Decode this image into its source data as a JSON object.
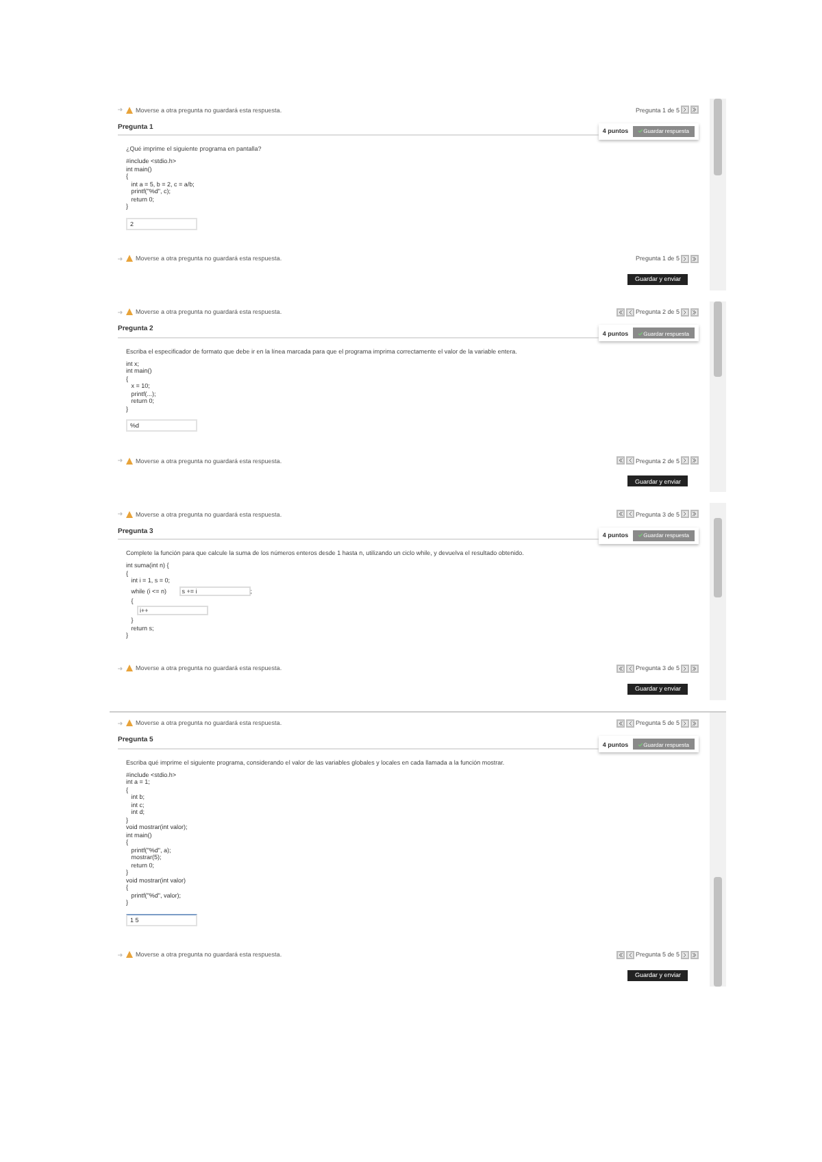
{
  "panels": [
    {
      "warning": "Moverse a otra pregunta no guardará esta respuesta.",
      "nav": {
        "label": "Pregunta 1 de 5",
        "previous": false
      },
      "question": {
        "title": "Pregunta 1",
        "points": "4 puntos",
        "save": "Guardar respuesta",
        "prompt": "¿Qué imprime el siguiente programa en pantalla?",
        "code": [
          [
            {
              "kind": "text",
              "text": "#include <stdio.h>"
            }
          ],
          [
            {
              "kind": "text",
              "text": "int main()"
            }
          ],
          [
            {
              "kind": "text",
              "text": "{"
            }
          ],
          [
            {
              "kind": "text",
              "text": "   int a = 5, b = 2, c = a/b;"
            }
          ],
          [
            {
              "kind": "text",
              "text": "   printf(\"%d\", c);"
            }
          ],
          [
            {
              "kind": "text",
              "text": "   return 0;"
            }
          ],
          [
            {
              "kind": "text",
              "text": "}"
            }
          ]
        ],
        "answer": "2"
      },
      "bottom_warning": "Moverse a otra pregunta no guardará esta respuesta.",
      "bottom_nav": {
        "label": "Pregunta 1 de 5",
        "previous": false
      },
      "action": "Guardar y enviar"
    },
    {
      "warning": "Moverse a otra pregunta no guardará esta respuesta.",
      "nav": {
        "label": "Pregunta 2 de 5",
        "previous": true
      },
      "question": {
        "title": "Pregunta 2",
        "points": "4 puntos",
        "save": "Guardar respuesta",
        "prompt": "Escriba el especificador de formato que debe ir en la línea marcada para que el programa imprima correctamente el valor de la variable entera.",
        "code": [
          [
            {
              "kind": "text",
              "text": "int x;"
            }
          ],
          [
            {
              "kind": "text",
              "text": "int main()"
            }
          ],
          [
            {
              "kind": "text",
              "text": "{"
            }
          ],
          [
            {
              "kind": "text",
              "text": "   x = 10;"
            }
          ],
          [
            {
              "kind": "text",
              "text": "   printf(...);"
            }
          ],
          [
            {
              "kind": "text",
              "text": "   return 0;"
            }
          ],
          [
            {
              "kind": "text",
              "text": "}"
            }
          ]
        ],
        "answer": "%d"
      },
      "bottom_warning": "Moverse a otra pregunta no guardará esta respuesta.",
      "bottom_nav": {
        "label": "Pregunta 2 de 5",
        "previous": true
      },
      "action": "Guardar y enviar"
    },
    {
      "warning": "Moverse a otra pregunta no guardará esta respuesta.",
      "nav": {
        "label": "Pregunta 3 de 5",
        "previous": true
      },
      "question": {
        "title": "Pregunta 3",
        "points": "4 puntos",
        "save": "Guardar respuesta",
        "prompt": "Complete la función para que calcule la suma de los números enteros desde 1 hasta n, utilizando un ciclo while, y devuelva el resultado obtenido.",
        "code": [
          [
            {
              "kind": "text",
              "text": "int suma(int n) {"
            }
          ],
          [
            {
              "kind": "text",
              "text": "{"
            }
          ],
          [
            {
              "kind": "text",
              "text": "   int i = 1, s = 0;"
            }
          ],
          [
            {
              "kind": "text",
              "text": "   while (i <= n) "
            },
            {
              "kind": "field",
              "text": "s += i"
            },
            {
              "kind": "text",
              "text": ";"
            }
          ],
          [
            {
              "kind": "text",
              "text": "   {"
            }
          ],
          [
            {
              "kind": "field",
              "text": "i++"
            }
          ],
          [
            {
              "kind": "text",
              "text": "   }"
            }
          ],
          [
            {
              "kind": "text",
              "text": "   return s;"
            }
          ],
          [
            {
              "kind": "text",
              "text": "}"
            }
          ]
        ]
      },
      "bottom_warning": "Moverse a otra pregunta no guardará esta respuesta.",
      "bottom_nav": {
        "label": "Pregunta 3 de 5",
        "previous": true
      },
      "action": "Guardar y enviar"
    },
    {
      "warning": "Moverse a otra pregunta no guardará esta respuesta.",
      "nav": {
        "label": "Pregunta 5 de 5",
        "previous": true
      },
      "question": {
        "title": "Pregunta 5",
        "points": "4 puntos",
        "save": "Guardar respuesta",
        "prompt": "Escriba qué imprime el siguiente programa, considerando el valor de las variables globales y locales en cada llamada a la función mostrar.",
        "code": [
          [
            {
              "kind": "text",
              "text": "#include <stdio.h>"
            }
          ],
          [
            {
              "kind": "text",
              "text": "int a = 1;"
            }
          ],
          [
            {
              "kind": "text",
              "text": "{"
            }
          ],
          [
            {
              "kind": "text",
              "text": "   int b;"
            }
          ],
          [
            {
              "kind": "text",
              "text": "   int c;"
            }
          ],
          [
            {
              "kind": "text",
              "text": "   int d;"
            }
          ],
          [
            {
              "kind": "text",
              "text": "}"
            }
          ],
          [
            {
              "kind": "text",
              "text": "void mostrar(int valor);"
            }
          ],
          [
            {
              "kind": "text",
              "text": "int main()"
            }
          ],
          [
            {
              "kind": "text",
              "text": "{"
            }
          ],
          [
            {
              "kind": "text",
              "text": "   printf(\"%d\", a);"
            }
          ],
          [
            {
              "kind": "text",
              "text": "   mostrar(5);"
            }
          ],
          [
            {
              "kind": "text",
              "text": "   return 0;"
            }
          ],
          [
            {
              "kind": "text",
              "text": "}"
            }
          ],
          [
            {
              "kind": "text",
              "text": "void mostrar(int valor)"
            }
          ],
          [
            {
              "kind": "text",
              "text": "{"
            }
          ],
          [
            {
              "kind": "text",
              "text": "   printf(\"%d\", valor);"
            }
          ],
          [
            {
              "kind": "text",
              "text": "}"
            }
          ]
        ],
        "answer": "1 5"
      },
      "bottom_warning": "Moverse a otra pregunta no guardará esta respuesta.",
      "bottom_nav": {
        "label": "Pregunta 5 de 5",
        "previous": true
      },
      "action": "Guardar y enviar"
    }
  ]
}
